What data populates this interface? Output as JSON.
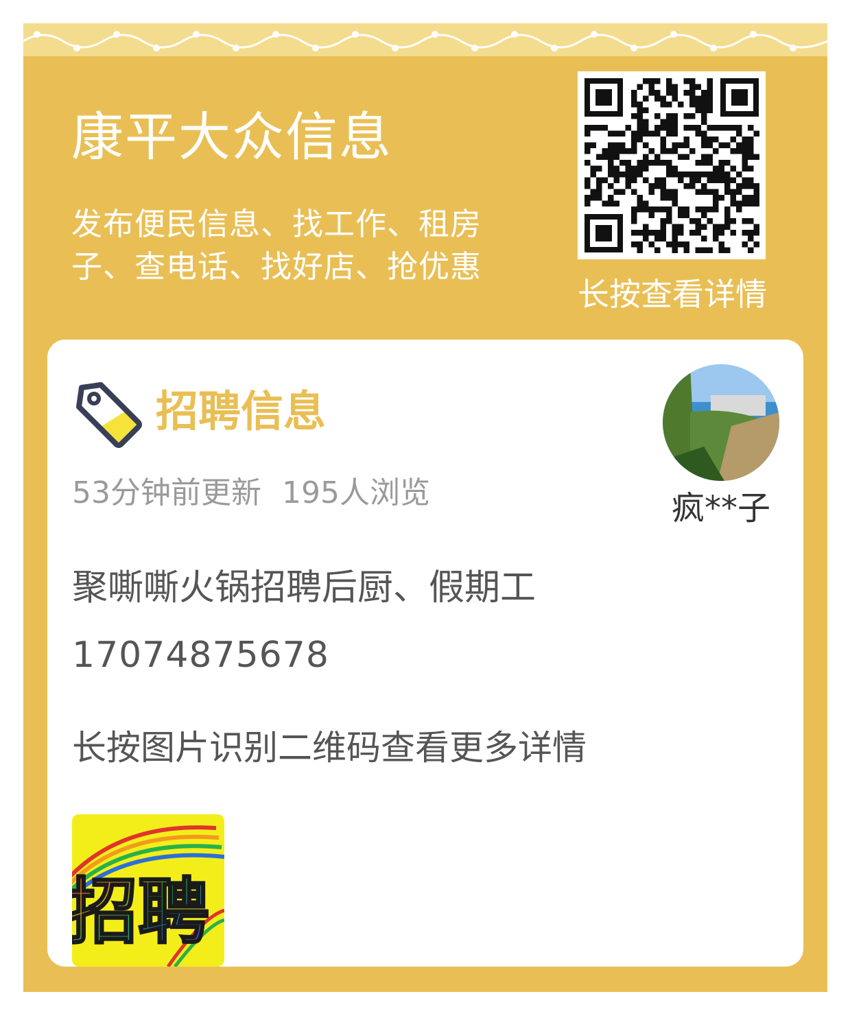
{
  "header": {
    "app_title": "康平大众信息",
    "app_desc": "发布便民信息、找工作、租房子、查电话、找好店、抢优惠",
    "qr_hint": "长按查看详情"
  },
  "post": {
    "category": "招聘信息",
    "updated": "53分钟前更新",
    "views": "195人浏览",
    "author": "疯**子",
    "title": "聚嘶嘶火锅招聘后厨、假期工",
    "phone": "17074875678",
    "qr_instruction": "长按图片识别二维码查看更多详情",
    "thumbnail_text": "招聘"
  },
  "icons": {
    "category_icon": "price-tag-icon",
    "qr": "qr-code",
    "decoration": "flower-lace-border"
  },
  "colors": {
    "background": "#e9bf55",
    "card": "#ffffff",
    "accent": "#e9bf55",
    "muted_text": "#9a9a9a",
    "body_text": "#555555",
    "thumbnail_bg": "#f3ee1a"
  }
}
